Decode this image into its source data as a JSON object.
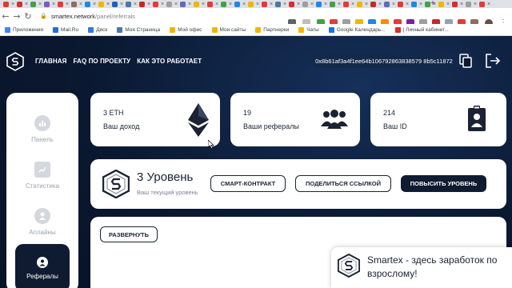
{
  "browser": {
    "url_host": "smartex.network",
    "url_path": "/panel/referrals",
    "bookmarks": [
      {
        "label": "Приложения",
        "color": "#4285f4"
      },
      {
        "label": "Mail.Ru",
        "color": "#1e6fd9"
      },
      {
        "label": "Диск",
        "color": "#2a7de1"
      },
      {
        "label": "Моя Страница",
        "color": "#4a76a8"
      },
      {
        "label": "Мой офис",
        "color": "#f4b400"
      },
      {
        "label": "Мои сайты",
        "color": "#f4b400"
      },
      {
        "label": "Партнерки",
        "color": "#f4b400"
      },
      {
        "label": "Чаты",
        "color": "#f4b400"
      },
      {
        "label": "Google Календарь...",
        "color": "#1a73e8"
      },
      {
        "label": "| Личный кабинет...",
        "color": "#d93025"
      }
    ]
  },
  "nav": {
    "items": [
      "ГЛАВНАЯ",
      "FAQ ПО ПРОЕКТУ",
      "КАК ЭТО РАБОТАЕТ"
    ],
    "wallet": "0x8b61af3a4f1ee64b106792863838579 8b5c11872"
  },
  "sidebar": {
    "items": [
      {
        "label": "Панель"
      },
      {
        "label": "Статистика"
      },
      {
        "label": "Аплайны"
      },
      {
        "label": "Рефералы"
      }
    ]
  },
  "cards": {
    "income": {
      "value": "3 ETH",
      "label": "Ваш доход",
      "icon": "ethereum-icon"
    },
    "referrals": {
      "value": "19",
      "label": "Ваши рефералы",
      "icon": "users-icon"
    },
    "id": {
      "value": "214",
      "label": "Ваш ID",
      "icon": "id-badge-icon"
    }
  },
  "level": {
    "title": "3 Уровень",
    "subtitle": "Ваш текущий уровень",
    "btn_contract": "СМАРТ-КОНТРАКТ",
    "btn_share": "ПОДЕЛИТЬСЯ ССЫЛКОЙ",
    "btn_upgrade": "ПОВЫСИТЬ УРОВЕНЬ"
  },
  "lower": {
    "expand": "РАЗВЕРНУТЬ"
  },
  "popup": {
    "text": "Smartex - здесь заработок по взрослому!"
  },
  "colors": {
    "dark": "#0f1b30",
    "page_bg": "#0a1830",
    "muted": "#9aa3b0"
  }
}
